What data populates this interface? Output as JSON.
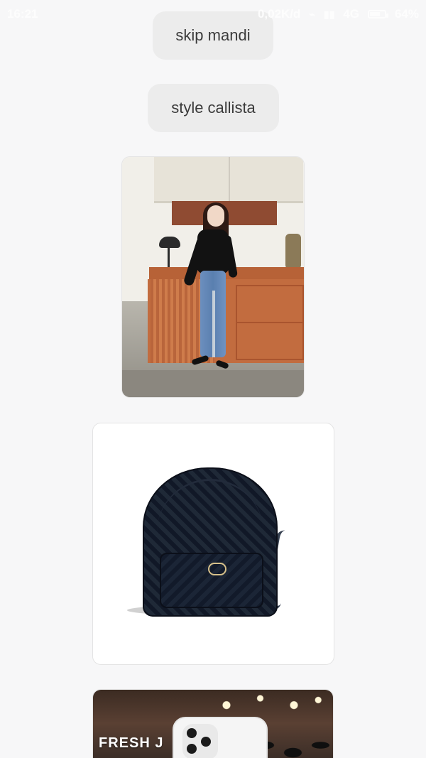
{
  "status_bar": {
    "time": "16:21",
    "data_rate": "0,02K/d",
    "network": "4G",
    "battery": "64%",
    "battery_level": 0.64
  },
  "chips": {
    "first": "skip mandi",
    "second": "style callista"
  },
  "cards": {
    "phone_photo_sign": "FRESH J"
  },
  "colors": {
    "background": "#f7f7f8",
    "chip": "#ececec",
    "chip_text": "#3b3b3b"
  },
  "icons": {
    "signal": "signal-icon",
    "wifi": "wifi-icon",
    "battery": "battery-icon"
  }
}
